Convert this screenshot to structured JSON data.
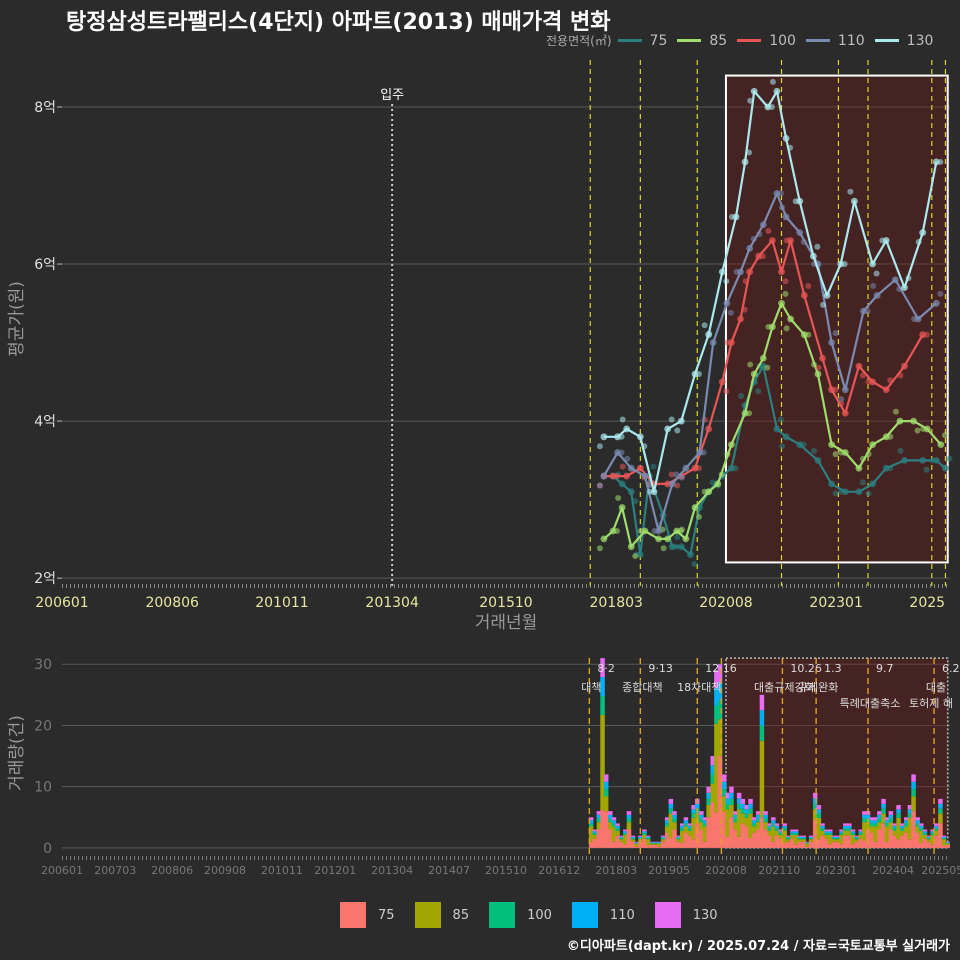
{
  "title": "탕정삼성트라팰리스(4단지) 아파트(2013) 매매가격 변화",
  "footer": "©디아파트(dapt.kr) / 2025.07.24 / 자료=국토교통부 실거래가",
  "chart_data": [
    {
      "type": "line",
      "ylabel": "평균가(원)",
      "xlabel": "거래년월",
      "y_tick_labels": [
        "2억",
        "4억",
        "6억",
        "8억"
      ],
      "y_ticks": [
        2,
        4,
        6,
        8
      ],
      "ylim": [
        1.9,
        8.7
      ],
      "x_tick_labels": [
        "200601",
        "200806",
        "201011",
        "201304",
        "201510",
        "201803",
        "202008",
        "202301",
        "2025"
      ],
      "x_ticks": [
        2006.0,
        2008.42,
        2010.83,
        2013.25,
        2015.75,
        2018.17,
        2020.58,
        2023.0,
        2025.0
      ],
      "xlim": [
        2006.0,
        2025.5
      ],
      "legend_title": "전용면적(㎡)",
      "legend_position": "top-right",
      "annotation_move_in": {
        "label": "입주",
        "x": 2013.25
      },
      "highlight_box": {
        "x": [
          2020.58,
          2025.45
        ],
        "y": [
          2.2,
          8.4
        ]
      },
      "policy_lines_x": [
        2017.6,
        2018.7,
        2019.95,
        2021.8,
        2023.05,
        2023.7,
        2025.1,
        2025.4
      ],
      "series": [
        {
          "name": "75",
          "color": "#2a7f7f",
          "points": [
            [
              2017.9,
              3.3
            ],
            [
              2018.1,
              3.3
            ],
            [
              2018.3,
              3.2
            ],
            [
              2018.5,
              3.1
            ],
            [
              2018.7,
              2.3
            ],
            [
              2018.9,
              3.3
            ],
            [
              2019.2,
              2.8
            ],
            [
              2019.4,
              2.4
            ],
            [
              2019.6,
              2.4
            ],
            [
              2019.8,
              2.3
            ],
            [
              2020.0,
              2.9
            ],
            [
              2020.2,
              3.1
            ],
            [
              2020.5,
              3.3
            ],
            [
              2020.7,
              3.4
            ],
            [
              2021.0,
              4.2
            ],
            [
              2021.2,
              4.5
            ],
            [
              2021.4,
              4.7
            ],
            [
              2021.7,
              3.9
            ],
            [
              2021.9,
              3.8
            ],
            [
              2022.2,
              3.7
            ],
            [
              2022.6,
              3.5
            ],
            [
              2022.9,
              3.2
            ],
            [
              2023.2,
              3.1
            ],
            [
              2023.5,
              3.1
            ],
            [
              2023.8,
              3.2
            ],
            [
              2024.1,
              3.4
            ],
            [
              2024.5,
              3.5
            ],
            [
              2024.9,
              3.5
            ],
            [
              2025.2,
              3.5
            ],
            [
              2025.4,
              3.4
            ]
          ]
        },
        {
          "name": "85",
          "color": "#9edd6b",
          "points": [
            [
              2017.9,
              2.5
            ],
            [
              2018.1,
              2.6
            ],
            [
              2018.3,
              2.9
            ],
            [
              2018.5,
              2.4
            ],
            [
              2018.8,
              2.6
            ],
            [
              2019.1,
              2.5
            ],
            [
              2019.3,
              2.5
            ],
            [
              2019.5,
              2.6
            ],
            [
              2019.7,
              2.5
            ],
            [
              2019.9,
              2.9
            ],
            [
              2020.2,
              3.1
            ],
            [
              2020.4,
              3.2
            ],
            [
              2020.7,
              3.7
            ],
            [
              2021.0,
              4.1
            ],
            [
              2021.2,
              4.6
            ],
            [
              2021.4,
              4.8
            ],
            [
              2021.6,
              5.2
            ],
            [
              2021.8,
              5.5
            ],
            [
              2022.0,
              5.3
            ],
            [
              2022.3,
              5.1
            ],
            [
              2022.6,
              4.6
            ],
            [
              2022.9,
              3.7
            ],
            [
              2023.2,
              3.6
            ],
            [
              2023.5,
              3.4
            ],
            [
              2023.8,
              3.7
            ],
            [
              2024.1,
              3.8
            ],
            [
              2024.4,
              4.0
            ],
            [
              2024.7,
              4.0
            ],
            [
              2025.0,
              3.9
            ],
            [
              2025.3,
              3.7
            ]
          ]
        },
        {
          "name": "100",
          "color": "#e85555",
          "points": [
            [
              2017.9,
              3.3
            ],
            [
              2018.1,
              3.3
            ],
            [
              2018.4,
              3.3
            ],
            [
              2018.7,
              3.4
            ],
            [
              2019.0,
              3.2
            ],
            [
              2019.3,
              3.2
            ],
            [
              2019.6,
              3.3
            ],
            [
              2019.9,
              3.4
            ],
            [
              2020.2,
              3.9
            ],
            [
              2020.5,
              4.5
            ],
            [
              2020.7,
              5.0
            ],
            [
              2020.9,
              5.3
            ],
            [
              2021.1,
              5.9
            ],
            [
              2021.3,
              6.1
            ],
            [
              2021.6,
              6.3
            ],
            [
              2021.8,
              5.9
            ],
            [
              2022.0,
              6.3
            ],
            [
              2022.3,
              5.6
            ],
            [
              2022.7,
              4.8
            ],
            [
              2022.9,
              4.4
            ],
            [
              2023.2,
              4.1
            ],
            [
              2023.5,
              4.7
            ],
            [
              2023.8,
              4.5
            ],
            [
              2024.1,
              4.4
            ],
            [
              2024.5,
              4.7
            ],
            [
              2024.9,
              5.1
            ]
          ]
        },
        {
          "name": "110",
          "color": "#7a8ab0",
          "points": [
            [
              2017.9,
              3.3
            ],
            [
              2018.2,
              3.6
            ],
            [
              2018.5,
              3.4
            ],
            [
              2018.8,
              3.3
            ],
            [
              2019.1,
              2.6
            ],
            [
              2019.4,
              3.2
            ],
            [
              2019.7,
              3.4
            ],
            [
              2020.0,
              3.6
            ],
            [
              2020.3,
              5.0
            ],
            [
              2020.6,
              5.5
            ],
            [
              2020.9,
              5.9
            ],
            [
              2021.1,
              6.2
            ],
            [
              2021.4,
              6.5
            ],
            [
              2021.7,
              6.9
            ],
            [
              2021.9,
              6.6
            ],
            [
              2022.2,
              6.4
            ],
            [
              2022.6,
              6.0
            ],
            [
              2022.9,
              5.0
            ],
            [
              2023.2,
              4.4
            ],
            [
              2023.6,
              5.4
            ],
            [
              2023.9,
              5.6
            ],
            [
              2024.3,
              5.8
            ],
            [
              2024.8,
              5.3
            ],
            [
              2025.2,
              5.5
            ]
          ]
        },
        {
          "name": "130",
          "color": "#aaeaee",
          "points": [
            [
              2017.9,
              3.8
            ],
            [
              2018.2,
              3.8
            ],
            [
              2018.4,
              3.9
            ],
            [
              2018.7,
              3.8
            ],
            [
              2019.0,
              3.1
            ],
            [
              2019.3,
              3.9
            ],
            [
              2019.6,
              4.0
            ],
            [
              2019.9,
              4.6
            ],
            [
              2020.2,
              5.1
            ],
            [
              2020.5,
              5.9
            ],
            [
              2020.8,
              6.6
            ],
            [
              2021.0,
              7.3
            ],
            [
              2021.2,
              8.2
            ],
            [
              2021.5,
              8.0
            ],
            [
              2021.7,
              8.2
            ],
            [
              2021.9,
              7.6
            ],
            [
              2022.2,
              6.8
            ],
            [
              2022.5,
              6.1
            ],
            [
              2022.8,
              5.6
            ],
            [
              2023.1,
              6.0
            ],
            [
              2023.4,
              6.8
            ],
            [
              2023.8,
              6.0
            ],
            [
              2024.1,
              6.3
            ],
            [
              2024.5,
              5.7
            ],
            [
              2024.9,
              6.4
            ],
            [
              2025.2,
              7.3
            ]
          ]
        }
      ]
    },
    {
      "type": "bar",
      "stacked": true,
      "ylabel": "거래량(건)",
      "y_ticks": [
        0,
        10,
        20,
        30
      ],
      "ylim": [
        -1,
        32
      ],
      "x_tick_labels": [
        "200601",
        "200703",
        "200806",
        "200908",
        "201011",
        "201201",
        "201304",
        "201407",
        "201510",
        "201612",
        "201803",
        "201905",
        "202008",
        "202110",
        "202301",
        "202404",
        "202505"
      ],
      "x_ticks": [
        2006.0,
        2007.17,
        2008.42,
        2009.58,
        2010.83,
        2012.0,
        2013.25,
        2014.5,
        2015.75,
        2016.92,
        2018.17,
        2019.33,
        2020.58,
        2021.75,
        2023.0,
        2024.25,
        2025.33
      ],
      "xlim": [
        2006.0,
        2025.5
      ],
      "legend_position": "bottom",
      "series_names": [
        "75",
        "85",
        "100",
        "110",
        "130"
      ],
      "series_colors": [
        "#f8766d",
        "#a3a500",
        "#00bf7d",
        "#00b0f6",
        "#e76bf3"
      ],
      "policy_lines": [
        {
          "x": 2017.58,
          "date": "8·2",
          "name": "대책"
        },
        {
          "x": 2018.7,
          "date": "9·13",
          "name": "종합대책"
        },
        {
          "x": 2019.95,
          "date": "12·16",
          "name": "18차대책"
        },
        {
          "x": 2020.48,
          "date": "",
          "name": ""
        },
        {
          "x": 2021.82,
          "date": "10.26",
          "name": "대출규제강화"
        },
        {
          "x": 2022.56,
          "date": "1.3",
          "name": "규제완화"
        },
        {
          "x": 2023.7,
          "date": "9.7",
          "name": "특례대출축소"
        },
        {
          "x": 2025.15,
          "date": "6.2",
          "name": "대출"
        }
      ],
      "extra_labels": [
        {
          "text": "토허제 해",
          "x": 2024.6
        }
      ],
      "highlight_box": {
        "x": [
          2020.58,
          2025.45
        ],
        "y": [
          0,
          31
        ]
      },
      "totals": [
        [
          2017.62,
          5
        ],
        [
          2017.7,
          3
        ],
        [
          2017.79,
          6
        ],
        [
          2017.87,
          31
        ],
        [
          2017.95,
          12
        ],
        [
          2018.04,
          6
        ],
        [
          2018.12,
          5
        ],
        [
          2018.2,
          4
        ],
        [
          2018.29,
          2
        ],
        [
          2018.37,
          3
        ],
        [
          2018.45,
          6
        ],
        [
          2018.54,
          2
        ],
        [
          2018.62,
          1
        ],
        [
          2018.7,
          2
        ],
        [
          2018.79,
          3
        ],
        [
          2018.87,
          2
        ],
        [
          2018.95,
          1
        ],
        [
          2019.04,
          1
        ],
        [
          2019.12,
          1
        ],
        [
          2019.2,
          2
        ],
        [
          2019.29,
          5
        ],
        [
          2019.37,
          8
        ],
        [
          2019.45,
          6
        ],
        [
          2019.54,
          2
        ],
        [
          2019.62,
          4
        ],
        [
          2019.7,
          5
        ],
        [
          2019.79,
          4
        ],
        [
          2019.87,
          7
        ],
        [
          2019.95,
          8
        ],
        [
          2020.04,
          6
        ],
        [
          2020.12,
          5
        ],
        [
          2020.2,
          10
        ],
        [
          2020.29,
          15
        ],
        [
          2020.37,
          29
        ],
        [
          2020.45,
          30
        ],
        [
          2020.54,
          12
        ],
        [
          2020.62,
          9
        ],
        [
          2020.7,
          10
        ],
        [
          2020.79,
          6
        ],
        [
          2020.87,
          9
        ],
        [
          2020.95,
          8
        ],
        [
          2021.04,
          7
        ],
        [
          2021.12,
          8
        ],
        [
          2021.2,
          5
        ],
        [
          2021.29,
          6
        ],
        [
          2021.37,
          25
        ],
        [
          2021.45,
          6
        ],
        [
          2021.54,
          4
        ],
        [
          2021.62,
          5
        ],
        [
          2021.7,
          4
        ],
        [
          2021.79,
          3
        ],
        [
          2021.87,
          4
        ],
        [
          2021.95,
          2
        ],
        [
          2022.04,
          3
        ],
        [
          2022.12,
          3
        ],
        [
          2022.2,
          2
        ],
        [
          2022.29,
          2
        ],
        [
          2022.37,
          1
        ],
        [
          2022.45,
          2
        ],
        [
          2022.54,
          9
        ],
        [
          2022.62,
          7
        ],
        [
          2022.7,
          4
        ],
        [
          2022.79,
          3
        ],
        [
          2022.87,
          3
        ],
        [
          2022.95,
          2
        ],
        [
          2023.04,
          2
        ],
        [
          2023.12,
          3
        ],
        [
          2023.2,
          4
        ],
        [
          2023.29,
          4
        ],
        [
          2023.37,
          3
        ],
        [
          2023.45,
          2
        ],
        [
          2023.54,
          3
        ],
        [
          2023.62,
          6
        ],
        [
          2023.7,
          6
        ],
        [
          2023.79,
          5
        ],
        [
          2023.87,
          5
        ],
        [
          2023.95,
          6
        ],
        [
          2024.04,
          8
        ],
        [
          2024.12,
          5
        ],
        [
          2024.2,
          6
        ],
        [
          2024.29,
          4
        ],
        [
          2024.37,
          7
        ],
        [
          2024.45,
          4
        ],
        [
          2024.54,
          5
        ],
        [
          2024.62,
          7
        ],
        [
          2024.7,
          12
        ],
        [
          2024.79,
          5
        ],
        [
          2024.87,
          4
        ],
        [
          2024.95,
          3
        ],
        [
          2025.04,
          2
        ],
        [
          2025.12,
          3
        ],
        [
          2025.2,
          4
        ],
        [
          2025.29,
          8
        ],
        [
          2025.37,
          2
        ],
        [
          2025.45,
          1
        ]
      ]
    }
  ]
}
